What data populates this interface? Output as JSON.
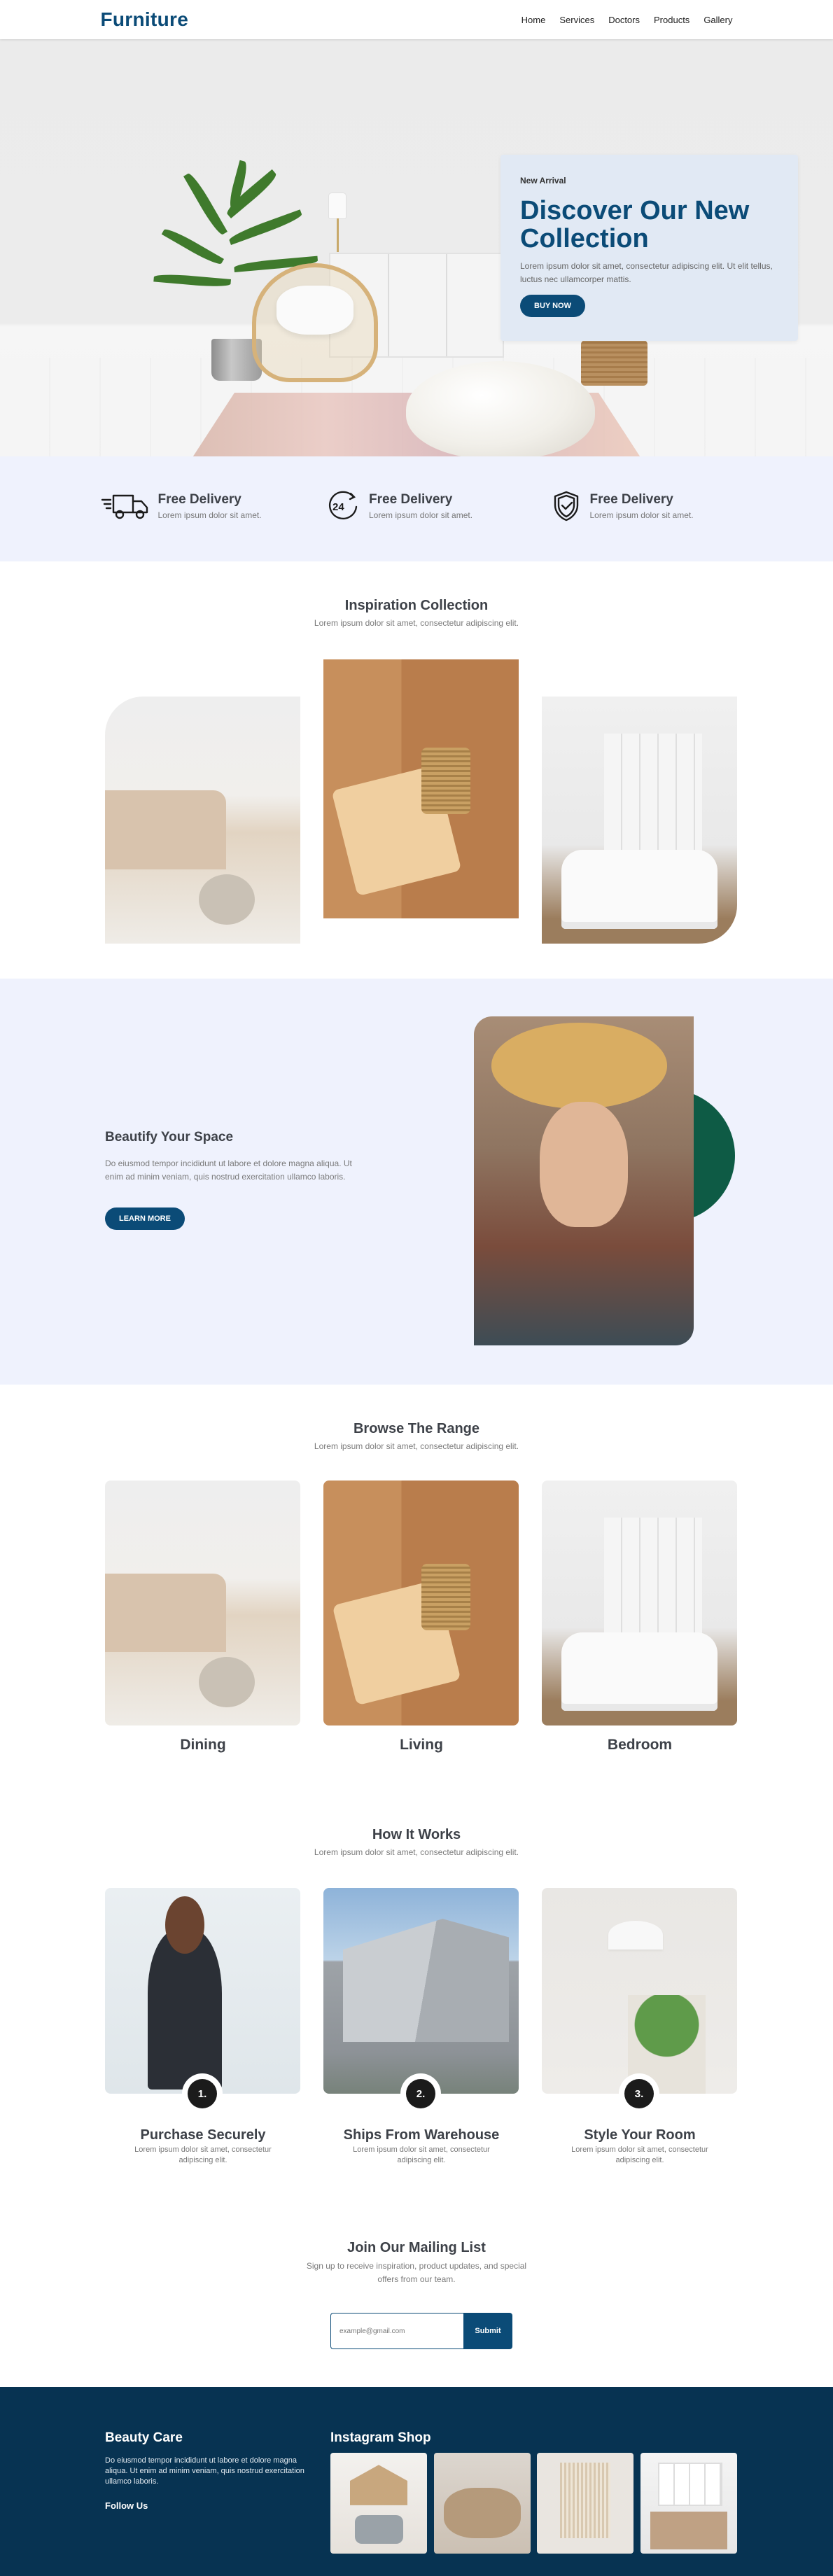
{
  "nav": {
    "logo": "Furniture",
    "links": [
      "Home",
      "Services",
      "Doctors",
      "Products",
      "Gallery"
    ]
  },
  "hero": {
    "eyebrow": "New Arrival",
    "title": "Discover Our New Collection",
    "text": "Lorem ipsum dolor sit amet, consectetur adipiscing elit. Ut elit tellus, luctus nec ullamcorper mattis.",
    "button": "BUY NOW"
  },
  "features": [
    {
      "icon": "delivery-truck-icon",
      "title": "Free Delivery",
      "text": "Lorem ipsum dolor sit amet."
    },
    {
      "icon": "24-hour-icon",
      "title": "Free Delivery",
      "text": "Lorem ipsum dolor sit amet."
    },
    {
      "icon": "shield-check-icon",
      "title": "Free Delivery",
      "text": "Lorem ipsum dolor sit amet."
    }
  ],
  "inspiration": {
    "title": "Inspiration Collection",
    "subtitle": "Lorem ipsum dolor sit amet, consectetur adipiscing elit."
  },
  "beautify": {
    "title": "Beautify Your Space",
    "text": "Do eiusmod tempor incididunt ut labore et dolore magna aliqua. Ut enim ad minim veniam, quis nostrud exercitation ullamco laboris.",
    "button": "LEARN MORE"
  },
  "browse": {
    "title": "Browse The Range",
    "subtitle": "Lorem ipsum dolor sit amet, consectetur adipiscing elit.",
    "items": [
      "Dining",
      "Living",
      "Bedroom"
    ]
  },
  "how": {
    "title": "How It Works",
    "subtitle": "Lorem ipsum dolor sit amet, consectetur adipiscing elit.",
    "steps": [
      {
        "number": "1.",
        "title": "Purchase Securely",
        "text": "Lorem ipsum dolor sit amet, consectetur adipiscing elit."
      },
      {
        "number": "2.",
        "title": "Ships From Warehouse",
        "text": "Lorem ipsum dolor sit amet, consectetur adipiscing elit."
      },
      {
        "number": "3.",
        "title": "Style Your Room",
        "text": "Lorem ipsum dolor sit amet, consectetur adipiscing elit."
      }
    ]
  },
  "mailing": {
    "title": "Join Our Mailing List",
    "text": "Sign up to receive inspiration, product updates, and special offers from our team.",
    "placeholder": "example@gmail.com",
    "button": "Submit"
  },
  "footer": {
    "brand_title": "Beauty Care",
    "brand_text": "Do eiusmod tempor incididunt ut labore et dolore magna aliqua. Ut enim ad minim veniam, quis nostrud exercitation ullamco laboris.",
    "follow": "Follow Us",
    "instagram_title": "Instagram Shop"
  },
  "colors": {
    "primary": "#0b4b77",
    "footer_bg": "#073352",
    "light_bg": "#eff2fd",
    "hero_card": "#e1e9f4",
    "accent_green": "#0e5b45"
  }
}
